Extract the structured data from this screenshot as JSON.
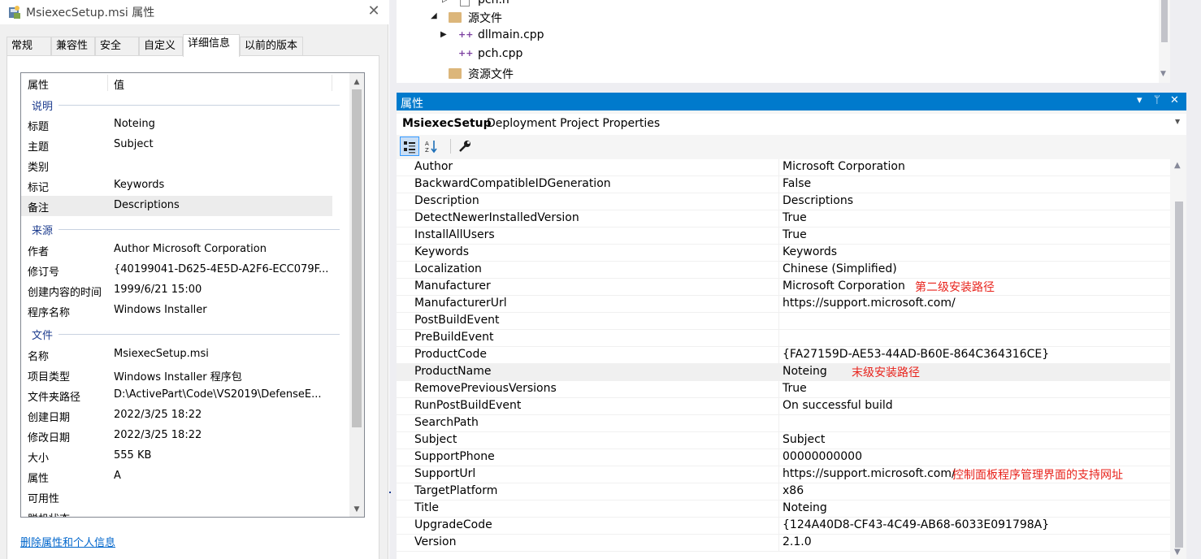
{
  "dialog": {
    "title": "MsiexecSetup.msi 属性",
    "close_glyph": "✕",
    "tabs": [
      {
        "label": "常规"
      },
      {
        "label": "兼容性"
      },
      {
        "label": "安全"
      },
      {
        "label": "自定义"
      },
      {
        "label": "详细信息",
        "active": true
      },
      {
        "label": "以前的版本"
      }
    ],
    "columns": {
      "property": "属性",
      "value": "值"
    },
    "groups": [
      {
        "name": "说明"
      },
      {
        "name": "来源"
      },
      {
        "name": "文件"
      }
    ],
    "rows": [
      {
        "k": "标题",
        "v": "Noteing"
      },
      {
        "k": "主题",
        "v": "Subject"
      },
      {
        "k": "类别",
        "v": ""
      },
      {
        "k": "标记",
        "v": "Keywords"
      },
      {
        "k": "备注",
        "v": "Descriptions"
      },
      {
        "k": "作者",
        "v": "Author Microsoft Corporation"
      },
      {
        "k": "修订号",
        "v": "{40199041-D625-4E5D-A2F6-ECC079F..."
      },
      {
        "k": "创建内容的时间",
        "v": "1999/6/21 15:00"
      },
      {
        "k": "程序名称",
        "v": "Windows Installer"
      },
      {
        "k": "名称",
        "v": "MsiexecSetup.msi"
      },
      {
        "k": "项目类型",
        "v": "Windows Installer 程序包"
      },
      {
        "k": "文件夹路径",
        "v": "D:\\ActivePart\\Code\\VS2019\\DefenseE..."
      },
      {
        "k": "创建日期",
        "v": "2022/3/25 18:22"
      },
      {
        "k": "修改日期",
        "v": "2022/3/25 18:22"
      },
      {
        "k": "大小",
        "v": "555 KB"
      },
      {
        "k": "属性",
        "v": "A"
      },
      {
        "k": "可用性",
        "v": ""
      },
      {
        "k": "脱机状态",
        "v": ""
      }
    ],
    "remove_link": "删除属性和个人信息"
  },
  "solution_tree": {
    "items": [
      {
        "label": "pch.h"
      },
      {
        "label": "源文件"
      },
      {
        "label": "dllmain.cpp"
      },
      {
        "label": "pch.cpp"
      },
      {
        "label": "资源文件"
      }
    ]
  },
  "properties_window": {
    "title": "属性",
    "header_controls": [
      "▾",
      "ᛘ",
      "✕"
    ],
    "object_name": "MsiexecSetup",
    "object_type": "Deployment Project Properties",
    "toolbar": [
      "categorized-icon",
      "alphabetical-icon",
      "property-pages-icon"
    ],
    "rows": [
      {
        "k": "Author",
        "v": "Microsoft Corporation"
      },
      {
        "k": "BackwardCompatibleIDGeneration",
        "v": "False"
      },
      {
        "k": "Description",
        "v": "Descriptions"
      },
      {
        "k": "DetectNewerInstalledVersion",
        "v": "True"
      },
      {
        "k": "InstallAllUsers",
        "v": "True"
      },
      {
        "k": "Keywords",
        "v": "Keywords"
      },
      {
        "k": "Localization",
        "v": "Chinese (Simplified)"
      },
      {
        "k": "Manufacturer",
        "v": "Microsoft Corporation"
      },
      {
        "k": "ManufacturerUrl",
        "v": "https://support.microsoft.com/"
      },
      {
        "k": "PostBuildEvent",
        "v": ""
      },
      {
        "k": "PreBuildEvent",
        "v": ""
      },
      {
        "k": "ProductCode",
        "v": "{FA27159D-AE53-44AD-B60E-864C364316CE}"
      },
      {
        "k": "ProductName",
        "v": "Noteing"
      },
      {
        "k": "RemovePreviousVersions",
        "v": "True"
      },
      {
        "k": "RunPostBuildEvent",
        "v": "On successful build"
      },
      {
        "k": "SearchPath",
        "v": ""
      },
      {
        "k": "Subject",
        "v": "Subject"
      },
      {
        "k": "SupportPhone",
        "v": "00000000000"
      },
      {
        "k": "SupportUrl",
        "v": "https://support.microsoft.com/"
      },
      {
        "k": "TargetPlatform",
        "v": "x86"
      },
      {
        "k": "Title",
        "v": "Noteing"
      },
      {
        "k": "UpgradeCode",
        "v": "{124A40D8-CF43-4C49-AB68-6033E091798A}"
      },
      {
        "k": "Version",
        "v": "2.1.0"
      }
    ],
    "annotations": {
      "manufacturer": "第二级安装路径",
      "product_name": "末级安装路径",
      "support_url": "控制面板程序管理界面的支持网址"
    },
    "annotation_color": "#e8231c",
    "accent": "#007acc"
  }
}
